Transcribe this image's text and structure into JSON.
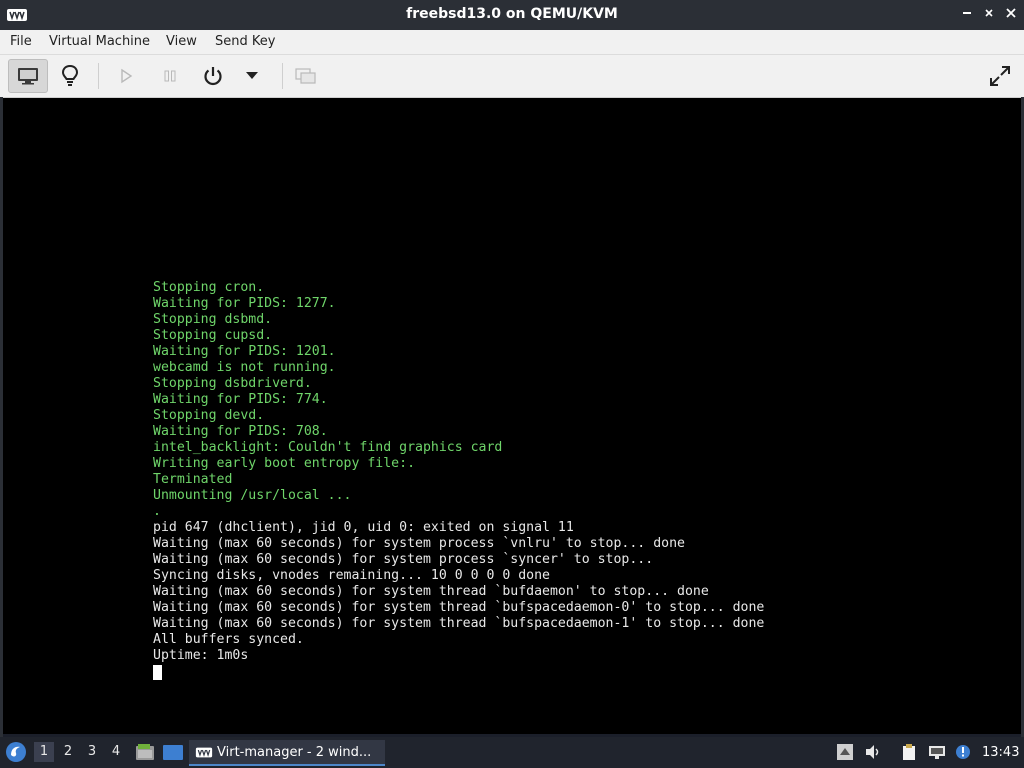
{
  "window": {
    "title": "freebsd13.0 on QEMU/KVM",
    "controls": [
      "minimize",
      "maximize",
      "close"
    ]
  },
  "menubar": {
    "items": [
      "File",
      "Virtual Machine",
      "View",
      "Send Key"
    ]
  },
  "toolbar": {
    "buttons": [
      {
        "name": "console-view",
        "icon": "monitor-icon",
        "active": true
      },
      {
        "name": "details-view",
        "icon": "lightbulb-icon",
        "active": false
      },
      {
        "name": "run",
        "icon": "play-icon",
        "enabled": false
      },
      {
        "name": "pause",
        "icon": "pause-icon",
        "enabled": false
      },
      {
        "name": "shutdown",
        "icon": "power-icon",
        "enabled": true
      },
      {
        "name": "shutdown-menu",
        "icon": "chevron-down-icon",
        "enabled": true
      },
      {
        "name": "snapshots",
        "icon": "snapshot-icon",
        "enabled": false
      },
      {
        "name": "fullscreen",
        "icon": "fullscreen-icon",
        "enabled": true
      }
    ]
  },
  "console": {
    "text_colors": {
      "green": "#6fd56a",
      "white": "#e8e8e8"
    },
    "lines": [
      {
        "text": "Stopping cron.",
        "color": "green"
      },
      {
        "text": "Waiting for PIDS: 1277.",
        "color": "green"
      },
      {
        "text": "Stopping dsbmd.",
        "color": "green"
      },
      {
        "text": "Stopping cupsd.",
        "color": "green"
      },
      {
        "text": "Waiting for PIDS: 1201.",
        "color": "green"
      },
      {
        "text": "webcamd is not running.",
        "color": "green"
      },
      {
        "text": "Stopping dsbdriverd.",
        "color": "green"
      },
      {
        "text": "Waiting for PIDS: 774.",
        "color": "green"
      },
      {
        "text": "Stopping devd.",
        "color": "green"
      },
      {
        "text": "Waiting for PIDS: 708.",
        "color": "green"
      },
      {
        "text": "intel_backlight: Couldn't find graphics card",
        "color": "green"
      },
      {
        "text": "Writing early boot entropy file:.",
        "color": "green"
      },
      {
        "text": "Terminated",
        "color": "green"
      },
      {
        "text": "Unmounting /usr/local ...",
        "color": "green"
      },
      {
        "text": ".",
        "color": "green"
      },
      {
        "text": "pid 647 (dhclient), jid 0, uid 0: exited on signal 11",
        "color": "white"
      },
      {
        "text": "Waiting (max 60 seconds) for system process `vnlru' to stop... done",
        "color": "white"
      },
      {
        "text": "Waiting (max 60 seconds) for system process `syncer' to stop...",
        "color": "white"
      },
      {
        "text": "Syncing disks, vnodes remaining... 10 0 0 0 0 done",
        "color": "white"
      },
      {
        "text": "Waiting (max 60 seconds) for system thread `bufdaemon' to stop... done",
        "color": "white"
      },
      {
        "text": "Waiting (max 60 seconds) for system thread `bufspacedaemon-0' to stop... done",
        "color": "white"
      },
      {
        "text": "Waiting (max 60 seconds) for system thread `bufspacedaemon-1' to stop... done",
        "color": "white"
      },
      {
        "text": "All buffers synced.",
        "color": "white"
      },
      {
        "text": "Uptime: 1m0s",
        "color": "white"
      }
    ]
  },
  "taskbar": {
    "workspaces": [
      "1",
      "2",
      "3",
      "4"
    ],
    "active_workspace": "1",
    "task_label": "Virt-manager - 2 wind...",
    "clock": "13:43",
    "accent": "#4d86c8"
  }
}
